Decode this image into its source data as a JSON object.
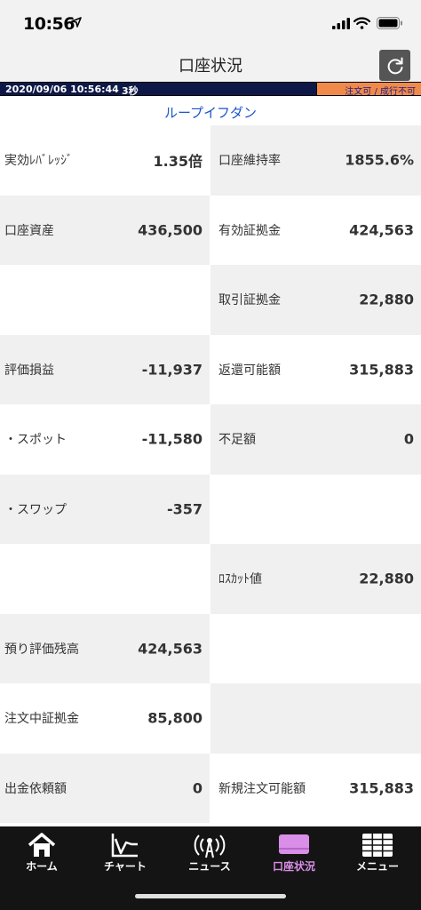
{
  "status_bar": {
    "time": "10:56"
  },
  "nav": {
    "title": "口座状況"
  },
  "info": {
    "datetime": "2020/09/06 10:56:44",
    "interval": "3秒",
    "order_status": "注文可 / 成行不可"
  },
  "strategy": {
    "name": "ループイフダン"
  },
  "rows": [
    {
      "left": {
        "label": "実効ﾚﾊﾞﾚｯｼﾞ",
        "value": "1.35倍"
      },
      "right": {
        "label": "口座維持率",
        "value": "1855.6%"
      }
    },
    {
      "left": {
        "label": "口座資産",
        "value": "436,500"
      },
      "right": {
        "label": "有効証拠金",
        "value": "424,563"
      }
    },
    {
      "left": {
        "label": "",
        "value": ""
      },
      "right": {
        "label": "取引証拠金",
        "value": "22,880"
      }
    },
    {
      "left": {
        "label": "評価損益",
        "value": "-11,937"
      },
      "right": {
        "label": "返還可能額",
        "value": "315,883"
      }
    },
    {
      "left": {
        "label": "・スポット",
        "value": "-11,580"
      },
      "right": {
        "label": "不足額",
        "value": "0"
      }
    },
    {
      "left": {
        "label": "・スワップ",
        "value": "-357"
      },
      "right": {
        "label": "",
        "value": ""
      }
    },
    {
      "left": {
        "label": "",
        "value": ""
      },
      "right": {
        "label": "ﾛｽｶｯﾄ値",
        "value": "22,880"
      }
    },
    {
      "left": {
        "label": "預り評価残高",
        "value": "424,563"
      },
      "right": {
        "label": "",
        "value": ""
      }
    },
    {
      "left": {
        "label": "注文中証拠金",
        "value": "85,800"
      },
      "right": {
        "label": "",
        "value": ""
      }
    },
    {
      "left": {
        "label": "出金依頼額",
        "value": "0"
      },
      "right": {
        "label": "新規注文可能額",
        "value": "315,883"
      }
    }
  ],
  "tabs": [
    {
      "label": "ホーム",
      "icon": "home-icon"
    },
    {
      "label": "チャート",
      "icon": "chart-icon"
    },
    {
      "label": "ニュース",
      "icon": "news-antenna-icon"
    },
    {
      "label": "口座状況",
      "icon": "account-icon",
      "active": true
    },
    {
      "label": "メニュー",
      "icon": "menu-grid-icon"
    }
  ],
  "colors": {
    "accent_tab": "#d98ee8",
    "link": "#1a55cc",
    "strip_bg": "#0d1848",
    "order_status_bg": "#f08a4b"
  }
}
